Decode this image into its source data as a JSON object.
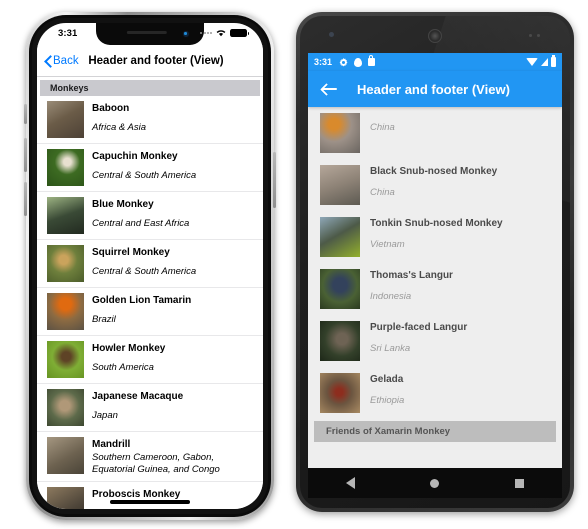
{
  "iphone": {
    "status": {
      "time": "3:31",
      "signal_icon": "signal-dots-icon",
      "wifi_icon": "wifi-icon",
      "battery_icon": "battery-icon"
    },
    "navbar": {
      "back_label": "Back",
      "title": "Header and footer (View)",
      "back_icon": "chevron-left-icon"
    },
    "section_header": "Monkeys",
    "rows": [
      {
        "name": "Baboon",
        "location": "Africa & Asia",
        "thumb": "#7d6e5c"
      },
      {
        "name": "Capuchin Monkey",
        "location": "Central & South America",
        "thumb": "#52772f"
      },
      {
        "name": "Blue Monkey",
        "location": "Central and East Africa",
        "thumb": "#5d7a55"
      },
      {
        "name": "Squirrel Monkey",
        "location": "Central & South America",
        "thumb": "#7b8d4e"
      },
      {
        "name": "Golden Lion Tamarin",
        "location": "Brazil",
        "thumb": "#8a7a62"
      },
      {
        "name": "Howler Monkey",
        "location": "South America",
        "thumb": "#6f9433"
      },
      {
        "name": "Japanese Macaque",
        "location": "Japan",
        "thumb": "#6e7a5b"
      },
      {
        "name": "Mandrill",
        "location": "Southern Cameroon, Gabon, Equatorial Guinea, and Congo",
        "thumb": "#7a6c58"
      },
      {
        "name": "Proboscis Monkey",
        "location": "",
        "thumb": "#6b6050"
      }
    ],
    "home_indicator": "home-indicator"
  },
  "android": {
    "status": {
      "time": "3:31",
      "icons": [
        "gear-icon",
        "shield-icon",
        "lock-icon"
      ],
      "right_icons": [
        "wifi-icon",
        "signal-icon",
        "battery-icon"
      ]
    },
    "appbar": {
      "back_icon": "arrow-left-icon",
      "title": "Header and footer (View)"
    },
    "rows": [
      {
        "name": "",
        "location": "China",
        "thumb": "#8c7f72"
      },
      {
        "name": "Black Snub-nosed Monkey",
        "location": "China",
        "thumb": "#8d8a80"
      },
      {
        "name": "Tonkin Snub-nosed Monkey",
        "location": "Vietnam",
        "thumb": "#6d7f63"
      },
      {
        "name": "Thomas's Langur",
        "location": "Indonesia",
        "thumb": "#3f5136"
      },
      {
        "name": "Purple-faced Langur",
        "location": "Sri Lanka",
        "thumb": "#3b4430"
      },
      {
        "name": "Gelada",
        "location": "Ethiopia",
        "thumb": "#8a6e53"
      }
    ],
    "footer": "Friends of Xamarin Monkey",
    "navbar": {
      "back": "nav-back-icon",
      "home": "nav-home-icon",
      "recents": "nav-recents-icon"
    }
  },
  "colors": {
    "ios_accent": "#007aff",
    "android_primary": "#2196f3",
    "ios_section_bg": "#c9c9ce",
    "android_footer_bg": "#bdbdbd",
    "android_page_bg": "#eeeeee"
  }
}
